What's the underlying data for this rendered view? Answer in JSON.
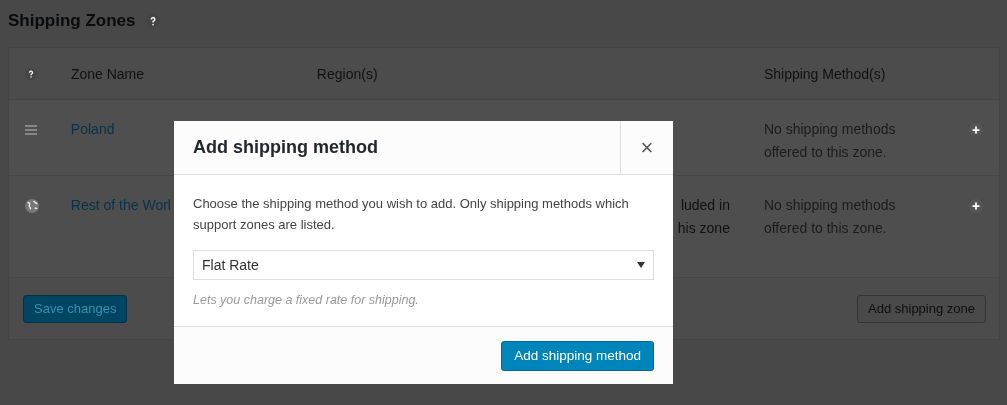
{
  "page": {
    "title": "Shipping Zones"
  },
  "table": {
    "columns": [
      "Zone Name",
      "Region(s)",
      "Shipping Method(s)"
    ],
    "rows": [
      {
        "kind": "drag",
        "zone_name": "Poland",
        "regions": [],
        "methods": "No shipping methods offered to this zone."
      },
      {
        "kind": "globe",
        "zone_name": "Rest of the Worl",
        "regions": [
          "luded in",
          "his zone"
        ],
        "methods": "No shipping methods offered to this zone."
      }
    ]
  },
  "footer": {
    "save_button": "Save changes",
    "save_disabled": true,
    "add_zone_button": "Add shipping zone"
  },
  "modal": {
    "title": "Add shipping method",
    "close": "×",
    "description": "Choose the shipping method you wish to add. Only shipping methods which support zones are listed.",
    "select_value": "Flat Rate",
    "hint": "Lets you charge a fixed rate for shipping.",
    "submit_button": "Add shipping method"
  }
}
